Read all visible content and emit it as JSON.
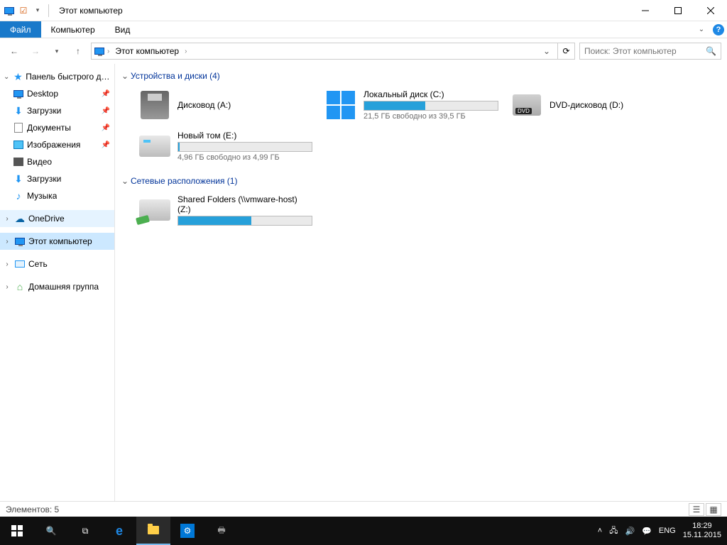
{
  "window": {
    "title": "Этот компьютер"
  },
  "ribbon": {
    "file": "Файл",
    "computer": "Компьютер",
    "view": "Вид"
  },
  "address": {
    "root": "Этот компьютер",
    "search_placeholder": "Поиск: Этот компьютер"
  },
  "sidebar": {
    "quick_access": "Панель быстрого доступа",
    "items": [
      {
        "label": "Desktop",
        "icon": "desktop",
        "pinned": true
      },
      {
        "label": "Загрузки",
        "icon": "downloads",
        "pinned": true
      },
      {
        "label": "Документы",
        "icon": "documents",
        "pinned": true
      },
      {
        "label": "Изображения",
        "icon": "pictures",
        "pinned": true
      },
      {
        "label": "Видео",
        "icon": "video",
        "pinned": false
      },
      {
        "label": "Загрузки",
        "icon": "downloads",
        "pinned": false
      },
      {
        "label": "Музыка",
        "icon": "music",
        "pinned": false
      }
    ],
    "onedrive": "OneDrive",
    "this_pc": "Этот компьютер",
    "network": "Сеть",
    "homegroup": "Домашняя группа"
  },
  "groups": {
    "devices": {
      "title": "Устройства и диски (4)"
    },
    "network": {
      "title": "Сетевые расположения (1)"
    }
  },
  "drives": {
    "floppy": {
      "name": "Дисковод (A:)"
    },
    "c": {
      "name": "Локальный диск (C:)",
      "info": "21,5 ГБ свободно из 39,5 ГБ",
      "used_pct": 46
    },
    "dvd": {
      "name": "DVD-дисковод (D:)"
    },
    "e": {
      "name": "Новый том (E:)",
      "info": "4,96 ГБ свободно из 4,99 ГБ",
      "used_pct": 1
    },
    "z": {
      "name": "Shared Folders (\\\\vmware-host) (Z:)",
      "info": "",
      "used_pct": 55
    }
  },
  "status": {
    "text": "Элементов: 5"
  },
  "tray": {
    "lang": "ENG",
    "time": "18:29",
    "date": "15.11.2015"
  }
}
